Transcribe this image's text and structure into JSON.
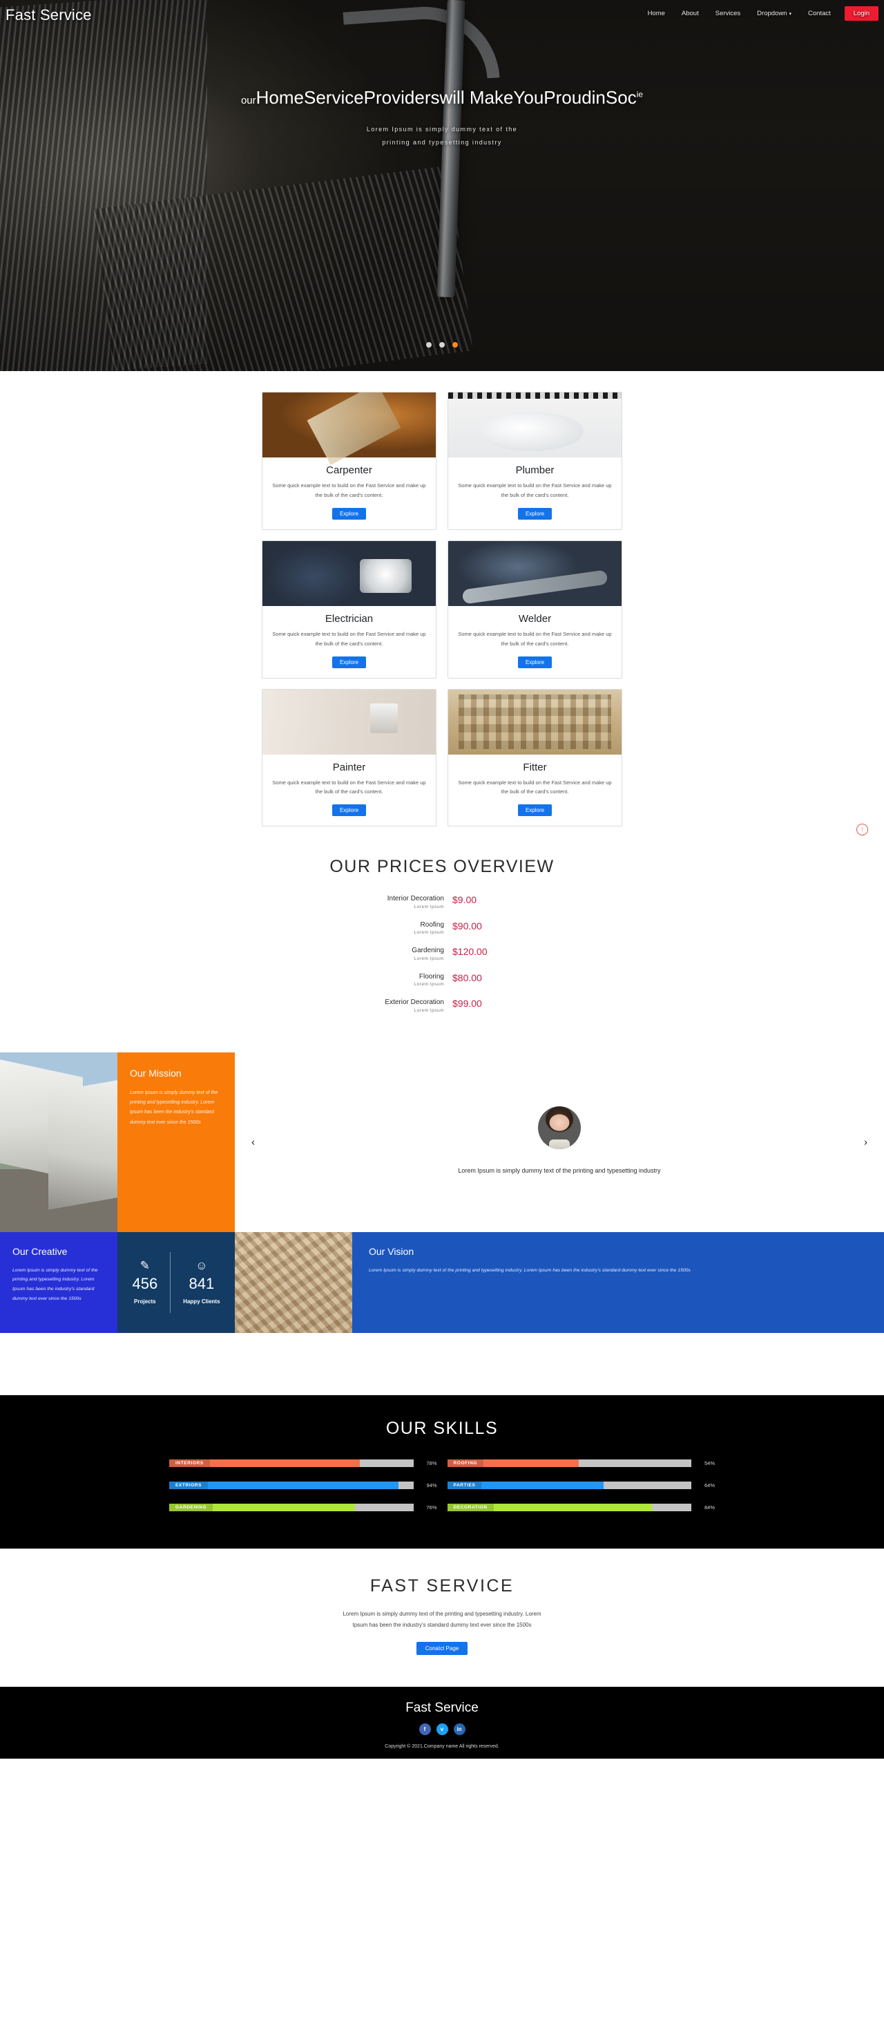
{
  "nav": {
    "brand": "Fast Service",
    "links": [
      {
        "label": "Home"
      },
      {
        "label": "About"
      },
      {
        "label": "Services"
      },
      {
        "label": "Dropdown",
        "caret": "▾"
      },
      {
        "label": "Contact"
      }
    ],
    "login_label": "Login"
  },
  "hero": {
    "title_main": "ourHomeServiceProviderswill MakeYouProudinSoci",
    "title_lead": "our",
    "title_rest": "HomeServiceProviderswill MakeYouProudinSoc",
    "title_tail": "ie",
    "subtitle_line1": "Lorem Ipsum is simply dummy text of the",
    "subtitle_line2": "printing and typesetting industry",
    "dots": [
      "inactive",
      "inactive",
      "active"
    ],
    "accent_dot_color": "#ff8c1a"
  },
  "scroll_top": {
    "icon": "↑",
    "color": "#e05a4a"
  },
  "services": {
    "cards": [
      {
        "title": "Carpenter",
        "text": "Some quick example text to build on the Fast Service and make up the bulk of the card's content.",
        "button": "Explore",
        "image": "carpenter"
      },
      {
        "title": "Plumber",
        "text": "Some quick example text to build on the Fast Service and make up the bulk of the card's content.",
        "button": "Explore",
        "image": "plumber"
      },
      {
        "title": "Electrician",
        "text": "Some quick example text to build on the Fast Service and make up the bulk of the card's content.",
        "button": "Explore",
        "image": "electrician"
      },
      {
        "title": "Welder",
        "text": "Some quick example text to build on the Fast Service and make up the bulk of the card's content.",
        "button": "Explore",
        "image": "welder"
      },
      {
        "title": "Painter",
        "text": "Some quick example text to build on the Fast Service and make up the bulk of the card's content.",
        "button": "Explore",
        "image": "painter"
      },
      {
        "title": "Fitter",
        "text": "Some quick example text to build on the Fast Service and make up the bulk of the card's content.",
        "button": "Explore",
        "image": "fitter"
      }
    ],
    "button_color": "#1273eb"
  },
  "prices": {
    "heading": "OUR PRICES OVERVIEW",
    "price_color": "#c32148",
    "items": [
      {
        "name": "Interior Decoration",
        "sub": "Lorem Ipsum",
        "value": "$9.00"
      },
      {
        "name": "Roofing",
        "sub": "Lorem Ipsum",
        "value": "$90.00"
      },
      {
        "name": "Gardening",
        "sub": "Lorem Ipsum",
        "value": "$120.00"
      },
      {
        "name": "Flooring",
        "sub": "Lorem Ipsum",
        "value": "$80.00"
      },
      {
        "name": "Exterior Decoration",
        "sub": "Lorem Ipsum",
        "value": "$99.00"
      }
    ]
  },
  "mission": {
    "heading": "Our Mission",
    "text": "Lorem Ipsum is simply dummy text of the printing and typesetting industry. Lorem Ipsum has been the industry's standard dummy text ever since the 1500s",
    "bg": "#f97b0a"
  },
  "testimonial": {
    "prev": "‹",
    "next": "›",
    "text": "Lorem Ipsum is simply dummy text of the printing and typesetting industry"
  },
  "creative": {
    "heading": "Our Creative",
    "text": "Lorem Ipsum is simply dummy text of the printing and typesetting industry. Lorem Ipsum has been the industry's standard dummy text ever since the 1500s",
    "bg": "#2730d6"
  },
  "stats": {
    "bg": "#133b63",
    "items": [
      {
        "icon": "✎",
        "number": "456",
        "label": "Projects"
      },
      {
        "icon": "☺",
        "number": "841",
        "label": "Happy Clients"
      }
    ]
  },
  "vision": {
    "heading": "Our Vision",
    "text": "Lorem Ipsum is simply dummy text of the printing and typesetting industry. Lorem Ipsum has been the industry's standard dummy text ever since the 1500s",
    "bg": "#1c56bd"
  },
  "skills": {
    "heading": "OUR SKILLS",
    "bars": [
      {
        "label": "INTERIORS",
        "percent": 78,
        "percent_label": "78%",
        "color": "#f2714b"
      },
      {
        "label": "ROOFING",
        "percent": 54,
        "percent_label": "54%",
        "color": "#f2714b"
      },
      {
        "label": "EXTRIORS",
        "percent": 94,
        "percent_label": "94%",
        "color": "#2196f3"
      },
      {
        "label": "PARTIES",
        "percent": 64,
        "percent_label": "64%",
        "color": "#2196f3"
      },
      {
        "label": "GARDENING",
        "percent": 76,
        "percent_label": "76%",
        "color": "#b0e838"
      },
      {
        "label": "DECORATION",
        "percent": 84,
        "percent_label": "84%",
        "color": "#b0e838"
      }
    ]
  },
  "contact": {
    "heading": "FAST SERVICE",
    "text": "Lorem Ipsum is simply dummy text of the printing and typesetting industry. Lorem Ipsum has been the industry's standard dummy text ever since the 1500s",
    "button": "Conatct Page"
  },
  "footer": {
    "brand": "Fast Service",
    "socials": [
      {
        "name": "facebook",
        "glyph": "f",
        "color": "#4267B2"
      },
      {
        "name": "twitter",
        "glyph": "ᴠ",
        "color": "#1DA1F2"
      },
      {
        "name": "linkedin",
        "glyph": "in",
        "color": "#2867B2"
      }
    ],
    "copyright": "Copyright © 2021.Company name All rights reserved."
  }
}
